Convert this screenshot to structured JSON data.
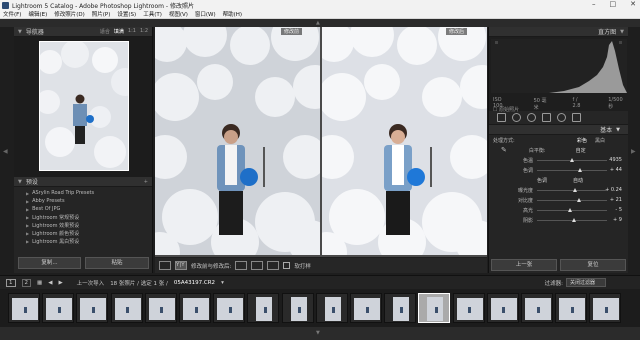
{
  "window": {
    "title": "Lightroom 5 Catalog - Adobe Photoshop Lightroom - 修改照片"
  },
  "menu": [
    "文件(F)",
    "编辑(E)",
    "修改照片(D)",
    "照片(P)",
    "设置(S)",
    "工具(T)",
    "视图(V)",
    "窗口(W)",
    "帮助(H)"
  ],
  "navigator": {
    "label": "导航器",
    "options": [
      "适合",
      "填满",
      "1:1",
      "1:2"
    ]
  },
  "presets": {
    "label": "预设",
    "items": [
      "ASrylin Road Trip Presets",
      "Abby Presets",
      "Best Of JPG",
      "Lightroom 常规预设",
      "Lightroom 效果预设",
      "Lightroom 颜色预设",
      "Lightroom 黑白预设"
    ]
  },
  "left_buttons": [
    "复制...",
    "粘贴"
  ],
  "compare": {
    "before_label": "修改前",
    "after_label": "修改后"
  },
  "center_toolbar": {
    "before_after_label": "修改前与修改后:",
    "soft_proof_label": "软打样",
    "yy": "Y|Y"
  },
  "histogram": {
    "label": "直方图",
    "iso": "ISO 100",
    "focal": "50 毫米",
    "aperture": "f / 2.8",
    "shutter": "1/500 秒",
    "original": "原始照片"
  },
  "basic": {
    "label": "基本",
    "treatment_label": "处理方式:",
    "treatment_color": "彩色",
    "treatment_bw": "黑白",
    "wb_label": "白平衡:",
    "wb_value": "自定",
    "tone_label": "色调",
    "auto_label": "自动",
    "sliders": [
      {
        "label": "色温",
        "value": "4935",
        "pos": 0.5
      },
      {
        "label": "色调",
        "value": "+ 44",
        "pos": 0.62
      },
      {
        "label": "曝光度",
        "value": "+ 0.24",
        "pos": 0.55
      },
      {
        "label": "对比度",
        "value": "+ 21",
        "pos": 0.6
      },
      {
        "label": "高光",
        "value": "- 5",
        "pos": 0.48
      },
      {
        "label": "阴影",
        "value": "+ 9",
        "pos": 0.53
      }
    ]
  },
  "right_buttons": [
    "上一张",
    "复位"
  ],
  "bottom_toolbar": {
    "prev_import": "上一次导入",
    "count_text": "18 张照片 / 选定 1 张 /",
    "filename": "05A43197.CR2",
    "filter_label": "过滤器:",
    "filter_value": "关闭过滤器"
  },
  "filmstrip": {
    "selected_index": 12,
    "thumbs": [
      "landscape",
      "landscape",
      "landscape",
      "landscape",
      "landscape",
      "landscape",
      "landscape",
      "portrait",
      "portrait",
      "portrait",
      "landscape",
      "portrait",
      "portrait",
      "landscape",
      "landscape",
      "landscape",
      "landscape",
      "landscape"
    ]
  },
  "colors": {
    "accent": "#3a6ea5",
    "panel": "#252525",
    "balloon": "#1e6fc8"
  }
}
